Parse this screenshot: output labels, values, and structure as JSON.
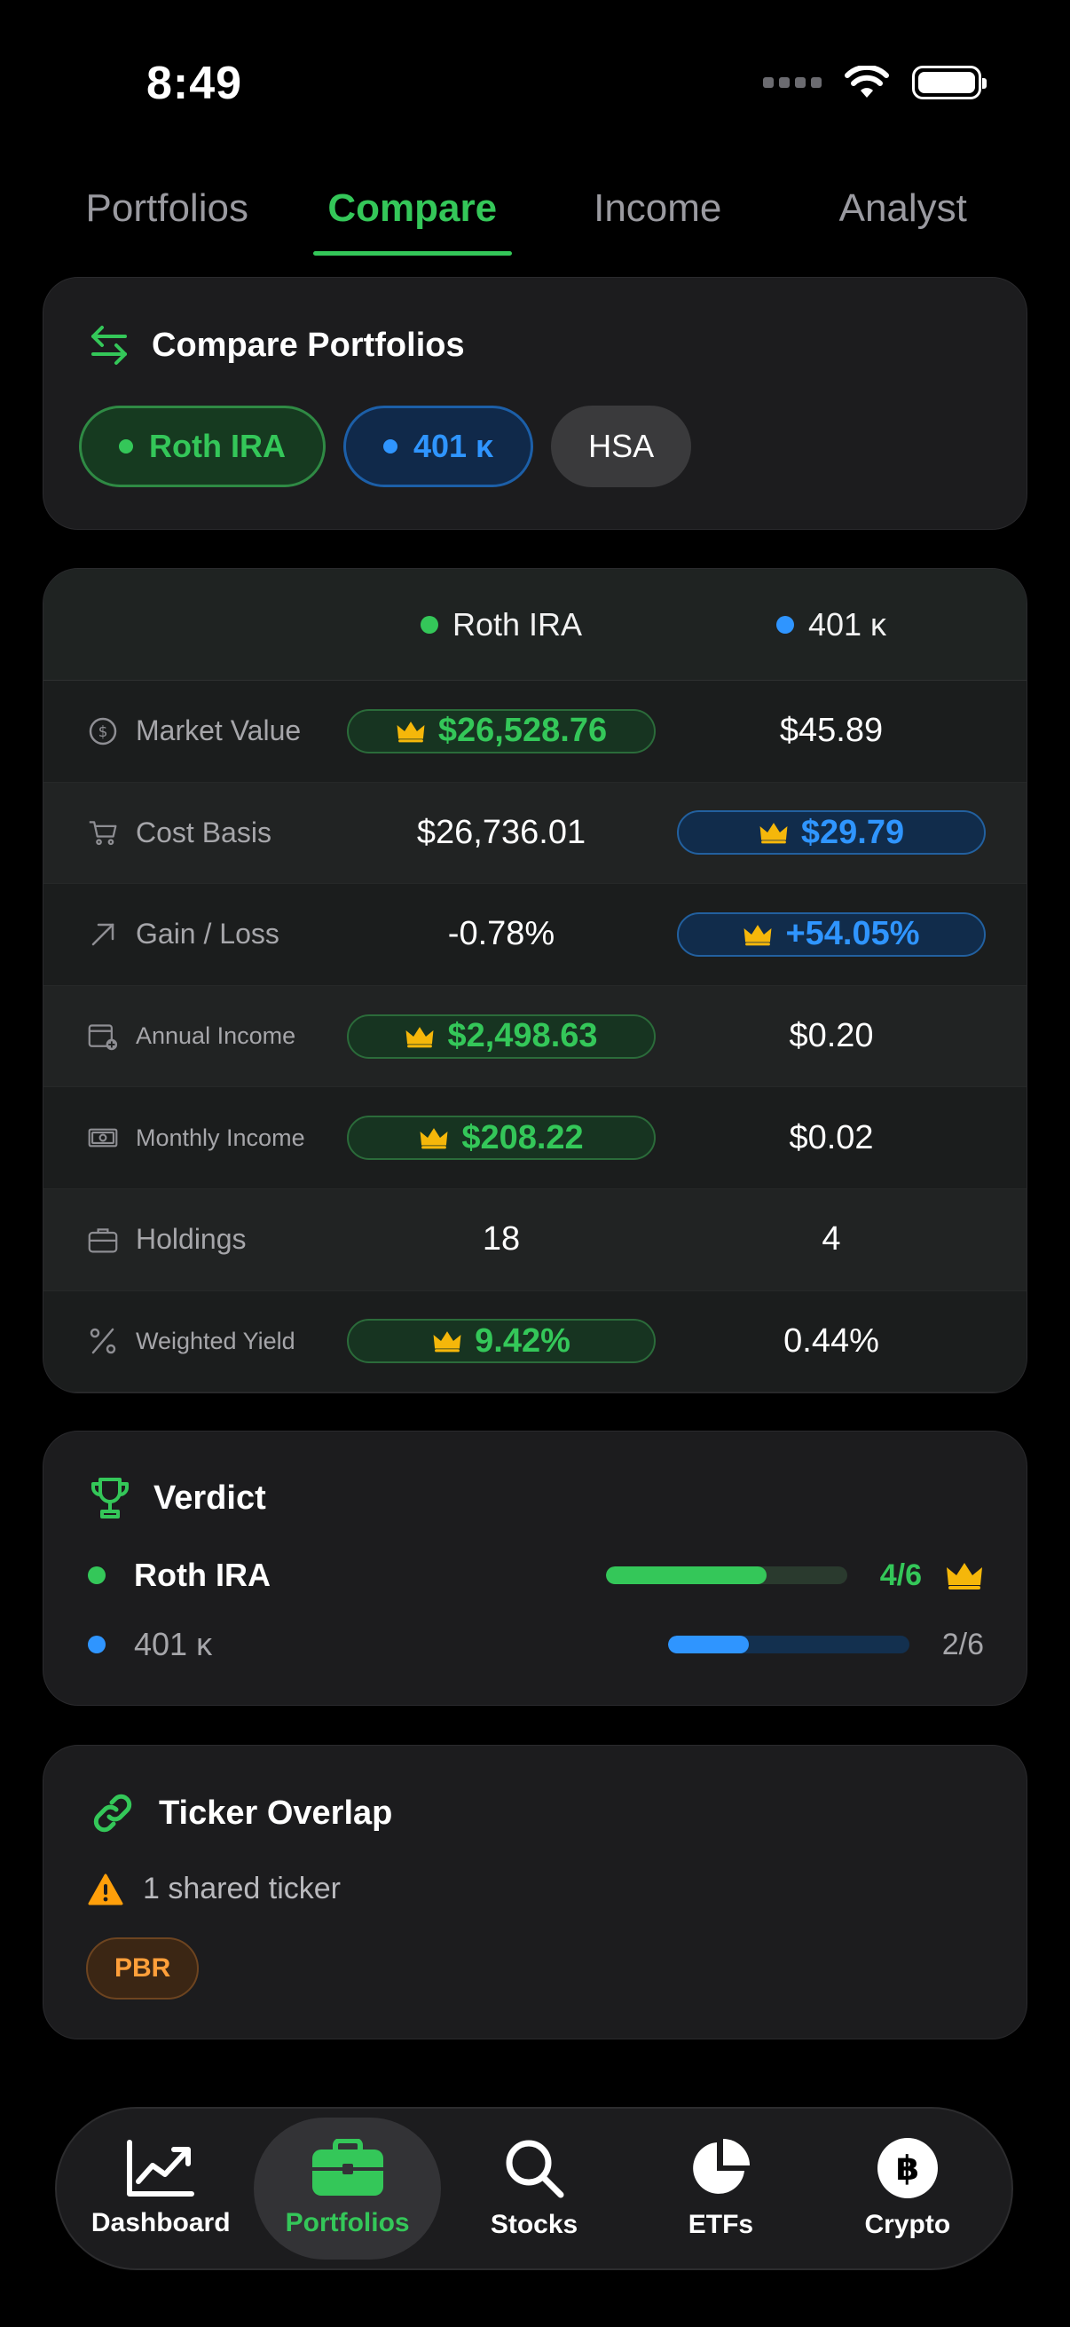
{
  "status_bar": {
    "time": "8:49"
  },
  "top_tabs": [
    {
      "label": "Portfolios",
      "active": false
    },
    {
      "label": "Compare",
      "active": true
    },
    {
      "label": "Income",
      "active": false
    },
    {
      "label": "Analyst",
      "active": false
    }
  ],
  "compare": {
    "title": "Compare Portfolios",
    "chips": [
      {
        "label": "Roth IRA",
        "color": "#34c759"
      },
      {
        "label": "401 κ",
        "color": "#2f95ff"
      },
      {
        "label": "HSA"
      }
    ]
  },
  "table": {
    "col_a": "Roth IRA",
    "col_b": "401 κ",
    "rows": [
      {
        "label": "Market Value",
        "icon": "dollar-circle-icon",
        "a": "$26,528.76",
        "b": "$45.89",
        "winner": "a"
      },
      {
        "label": "Cost Basis",
        "icon": "cart-icon",
        "a": "$26,736.01",
        "b": "$29.79",
        "winner": "b"
      },
      {
        "label": "Gain / Loss",
        "icon": "arrow-up-right-icon",
        "a": "-0.78%",
        "b": "+54.05%",
        "winner": "b"
      },
      {
        "label": "Annual Income",
        "icon": "calendar-plus-icon",
        "a": "$2,498.63",
        "b": "$0.20",
        "winner": "a"
      },
      {
        "label": "Monthly Income",
        "icon": "banknote-icon",
        "a": "$208.22",
        "b": "$0.02",
        "winner": "a"
      },
      {
        "label": "Holdings",
        "icon": "briefcase-icon",
        "a": "18",
        "b": "4",
        "winner": ""
      },
      {
        "label": "Weighted Yield",
        "icon": "percent-icon",
        "a": "9.42%",
        "b": "0.44%",
        "winner": "a"
      }
    ]
  },
  "verdict": {
    "title": "Verdict",
    "rows": [
      {
        "name": "Roth IRA",
        "score": "4/6",
        "wins": 4,
        "total": 6,
        "color": "#34c759",
        "leader": true
      },
      {
        "name": "401 κ",
        "score": "2/6",
        "wins": 2,
        "total": 6,
        "color": "#2f95ff",
        "leader": false
      }
    ]
  },
  "overlap": {
    "title": "Ticker Overlap",
    "warning": "1 shared ticker",
    "tickers": [
      "PBR"
    ]
  },
  "bottom_nav": [
    {
      "label": "Dashboard",
      "icon": "chart-line-icon",
      "active": false
    },
    {
      "label": "Portfolios",
      "icon": "briefcase-icon",
      "active": true
    },
    {
      "label": "Stocks",
      "icon": "search-icon",
      "active": false
    },
    {
      "label": "ETFs",
      "icon": "pie-chart-icon",
      "active": false
    },
    {
      "label": "Crypto",
      "icon": "bitcoin-icon",
      "active": false
    }
  ]
}
